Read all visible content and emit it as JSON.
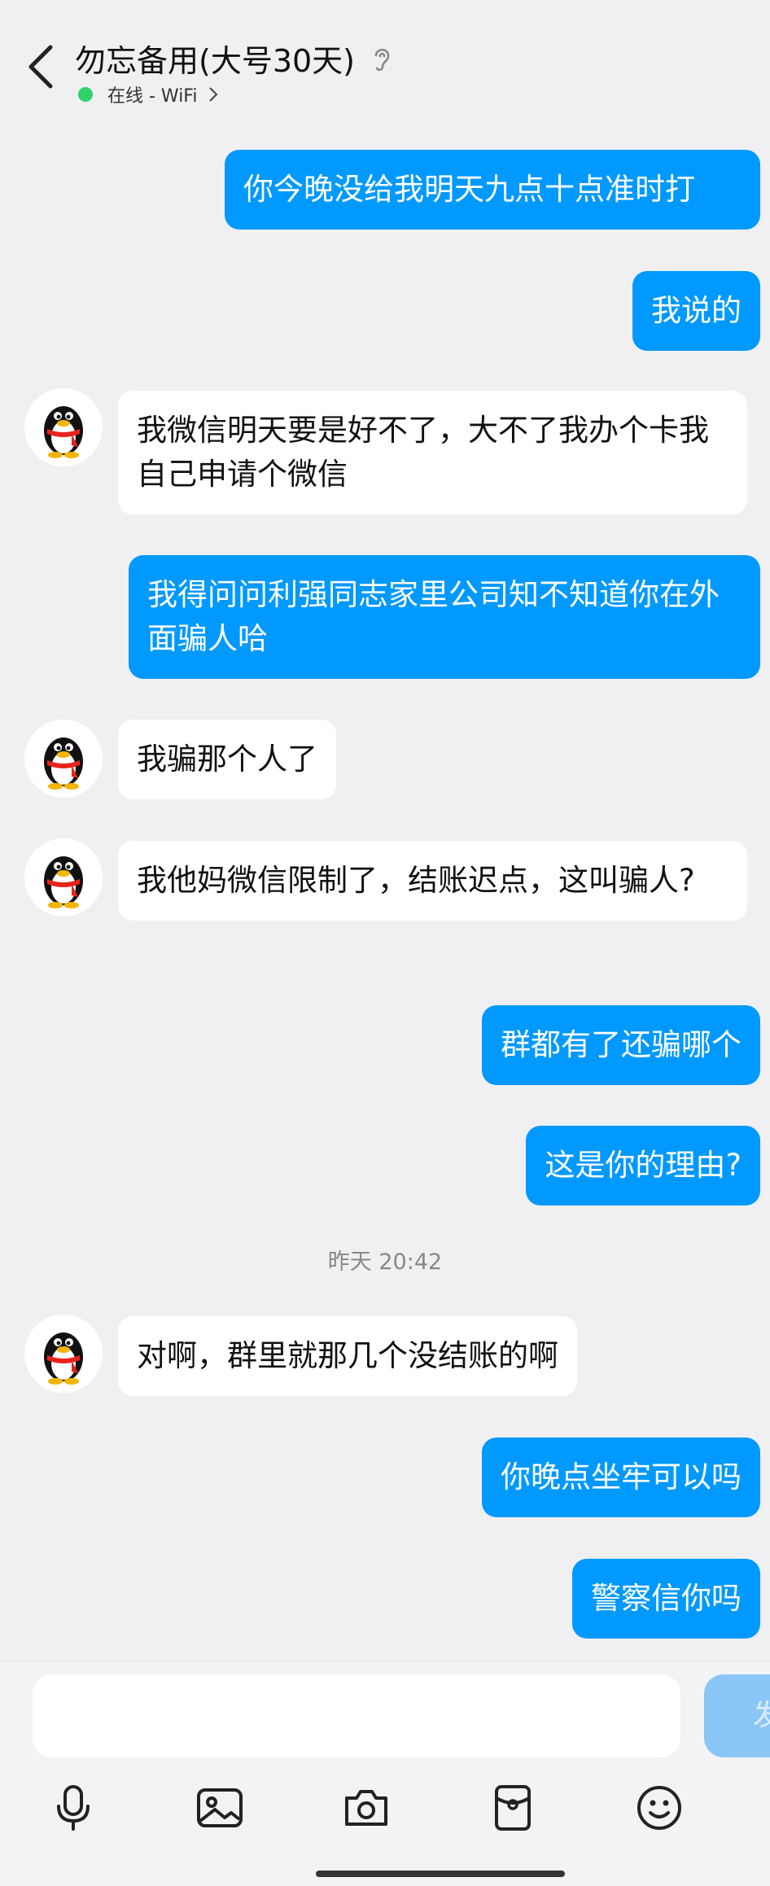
{
  "header": {
    "title": "勿忘备用(大号30天)",
    "status": "在线 - WiFi",
    "status_color": "#2fd16b"
  },
  "messages": [
    {
      "from": "me",
      "text": "你今晚没给我明天九点十点准时打"
    },
    {
      "from": "me",
      "text": "我说的"
    },
    {
      "from": "other",
      "text": "我微信明天要是好不了，大不了我办个卡我自己申请个微信"
    },
    {
      "from": "me",
      "text": "我得问问利强同志家里公司知不知道你在外面骗人哈"
    },
    {
      "from": "other",
      "text": "我骗那个人了"
    },
    {
      "from": "other",
      "text": "我他妈微信限制了，结账迟点，这叫骗人?"
    },
    {
      "from": "me",
      "text": "群都有了还骗哪个"
    },
    {
      "from": "me",
      "text": "这是你的理由?"
    },
    {
      "timestamp": "昨天 20:42"
    },
    {
      "from": "other",
      "text": "对啊，群里就那几个没结账的啊"
    },
    {
      "from": "me",
      "text": "你晚点坐牢可以吗"
    },
    {
      "from": "me",
      "text": "警察信你吗"
    }
  ],
  "input": {
    "placeholder": "",
    "send_label": "发"
  },
  "toolbar": {
    "icons": [
      "microphone-icon",
      "image-icon",
      "camera-icon",
      "red-packet-icon",
      "emoji-icon"
    ]
  },
  "colors": {
    "my_bubble": "#0099ff",
    "other_bubble": "#ffffff",
    "background": "#f0f0f3",
    "send_button": "#8ac7f7"
  }
}
